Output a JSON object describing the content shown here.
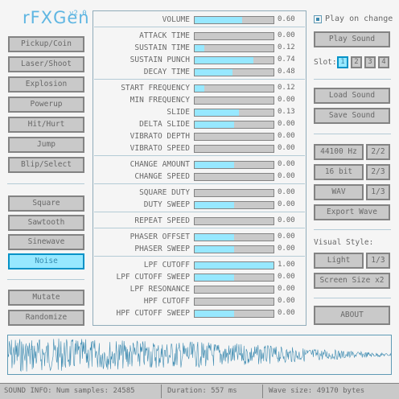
{
  "app": {
    "title": "rFXGen",
    "version": "v2.0"
  },
  "generators": [
    {
      "label": "Pickup/Coin"
    },
    {
      "label": "Laser/Shoot"
    },
    {
      "label": "Explosion"
    },
    {
      "label": "Powerup"
    },
    {
      "label": "Hit/Hurt"
    },
    {
      "label": "Jump"
    },
    {
      "label": "Blip/Select"
    }
  ],
  "waveforms": [
    {
      "label": "Square",
      "selected": false
    },
    {
      "label": "Sawtooth",
      "selected": false
    },
    {
      "label": "Sinewave",
      "selected": false
    },
    {
      "label": "Noise",
      "selected": true
    }
  ],
  "actions": {
    "mutate": "Mutate",
    "randomize": "Randomize"
  },
  "params": [
    {
      "label": "VOLUME",
      "value": "0.60",
      "fill": 0.6
    },
    {
      "label": "ATTACK TIME",
      "value": "0.00",
      "fill": 0.0
    },
    {
      "label": "SUSTAIN TIME",
      "value": "0.12",
      "fill": 0.12
    },
    {
      "label": "SUSTAIN PUNCH",
      "value": "0.74",
      "fill": 0.74
    },
    {
      "label": "DECAY TIME",
      "value": "0.48",
      "fill": 0.48
    },
    {
      "label": "START FREQUENCY",
      "value": "0.12",
      "fill": 0.12
    },
    {
      "label": "MIN FREQUENCY",
      "value": "0.00",
      "fill": 0.0
    },
    {
      "label": "SLIDE",
      "value": "0.13",
      "fill": 0.565
    },
    {
      "label": "DELTA SLIDE",
      "value": "0.00",
      "fill": 0.5
    },
    {
      "label": "VIBRATO DEPTH",
      "value": "0.00",
      "fill": 0.0
    },
    {
      "label": "VIBRATO SPEED",
      "value": "0.00",
      "fill": 0.0
    },
    {
      "label": "CHANGE AMOUNT",
      "value": "0.00",
      "fill": 0.5
    },
    {
      "label": "CHANGE SPEED",
      "value": "0.00",
      "fill": 0.0
    },
    {
      "label": "SQUARE DUTY",
      "value": "0.00",
      "fill": 0.0
    },
    {
      "label": "DUTY SWEEP",
      "value": "0.00",
      "fill": 0.5
    },
    {
      "label": "REPEAT SPEED",
      "value": "0.00",
      "fill": 0.0
    },
    {
      "label": "PHASER OFFSET",
      "value": "0.00",
      "fill": 0.5
    },
    {
      "label": "PHASER SWEEP",
      "value": "0.00",
      "fill": 0.5
    },
    {
      "label": "LPF CUTOFF",
      "value": "1.00",
      "fill": 1.0
    },
    {
      "label": "LPF CUTOFF SWEEP",
      "value": "0.00",
      "fill": 0.5
    },
    {
      "label": "LPF RESONANCE",
      "value": "0.00",
      "fill": 0.0
    },
    {
      "label": "HPF CUTOFF",
      "value": "0.00",
      "fill": 0.0
    },
    {
      "label": "HPF CUTOFF SWEEP",
      "value": "0.00",
      "fill": 0.5
    }
  ],
  "right": {
    "play_on_change": "Play on change",
    "play_on_change_checked": true,
    "play_sound": "Play Sound",
    "slot_label": "Slot:",
    "slots": [
      {
        "label": "1",
        "selected": true
      },
      {
        "label": "2",
        "selected": false
      },
      {
        "label": "3",
        "selected": false
      },
      {
        "label": "4",
        "selected": false
      }
    ],
    "load_sound": "Load Sound",
    "save_sound": "Save Sound",
    "sample_rate": "44100 Hz",
    "sample_rate_page": "2/2",
    "bit_depth": "16 bit",
    "bit_depth_page": "2/3",
    "format": "WAV",
    "format_page": "1/3",
    "export_wave": "Export Wave",
    "visual_style_label": "Visual Style:",
    "style": "Light",
    "style_page": "1/3",
    "screen_size": "Screen Size x2",
    "about": "ABOUT"
  },
  "status": {
    "info": "SOUND INFO: Num samples: 24585",
    "duration": "Duration: 557 ms",
    "wave_size": "Wave size: 49170 bytes"
  },
  "colors": {
    "accent": "#97e8ff",
    "accent_border": "#0492c7",
    "wave": "#3c8ab0"
  }
}
